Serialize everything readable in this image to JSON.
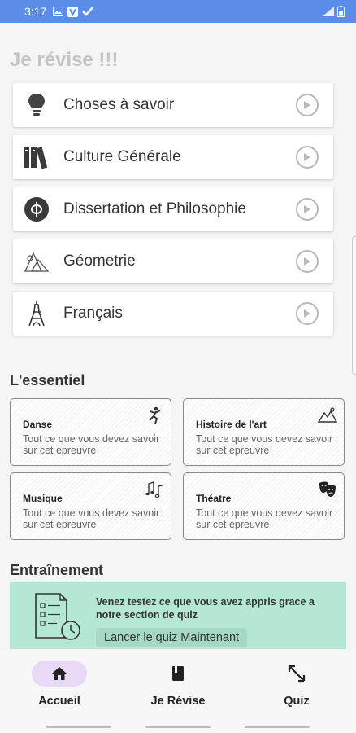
{
  "status_bar": {
    "time": "3:17",
    "icons": [
      "image-icon",
      "app-v-icon",
      "check-icon"
    ],
    "right_icons": [
      "signal-icon",
      "battery-icon"
    ]
  },
  "page": {
    "title": "Je révise !!!"
  },
  "subjects": [
    {
      "label": "Choses à savoir",
      "icon": "lightbulb-icon"
    },
    {
      "label": "Culture Générale",
      "icon": "books-icon"
    },
    {
      "label": "Dissertation et Philosophie",
      "icon": "phi-icon"
    },
    {
      "label": "Géometrie",
      "icon": "geometry-icon"
    },
    {
      "label": "Français",
      "icon": "eiffel-tower-icon"
    }
  ],
  "essentiel": {
    "title": "L'essentiel",
    "cards": [
      {
        "title": "Danse",
        "desc": "Tout ce que vous devez savoir sur cet epreuvre",
        "icon": "dancer-icon"
      },
      {
        "title": "Histoire de l'art",
        "desc": "Tout ce que vous devez savoir sur cet epreuvre",
        "icon": "landscape-art-icon"
      },
      {
        "title": "Musique",
        "desc": "Tout ce que vous devez savoir sur cet epreuvre",
        "icon": "music-notes-icon"
      },
      {
        "title": "Théatre",
        "desc": "Tout ce que vous devez savoir sur cet epreuvre",
        "icon": "theatre-masks-icon"
      }
    ]
  },
  "training": {
    "title": "Entraînement",
    "text": "Venez testez ce que vous avez appris grace a notre section de quiz",
    "button": "Lancer le quiz Maintenant",
    "icon": "quiz-clipboard-icon",
    "background": "#b5e8d3"
  },
  "bottom_nav": [
    {
      "label": "Accueil",
      "icon": "home-icon",
      "active": true
    },
    {
      "label": "Je Révise",
      "icon": "book-icon",
      "active": false
    },
    {
      "label": "Quiz",
      "icon": "arrows-expand-icon",
      "active": false
    }
  ],
  "colors": {
    "status_bar": "#5b8de8",
    "active_nav": "#e8d9f6",
    "title_muted": "#c4c4c4"
  }
}
